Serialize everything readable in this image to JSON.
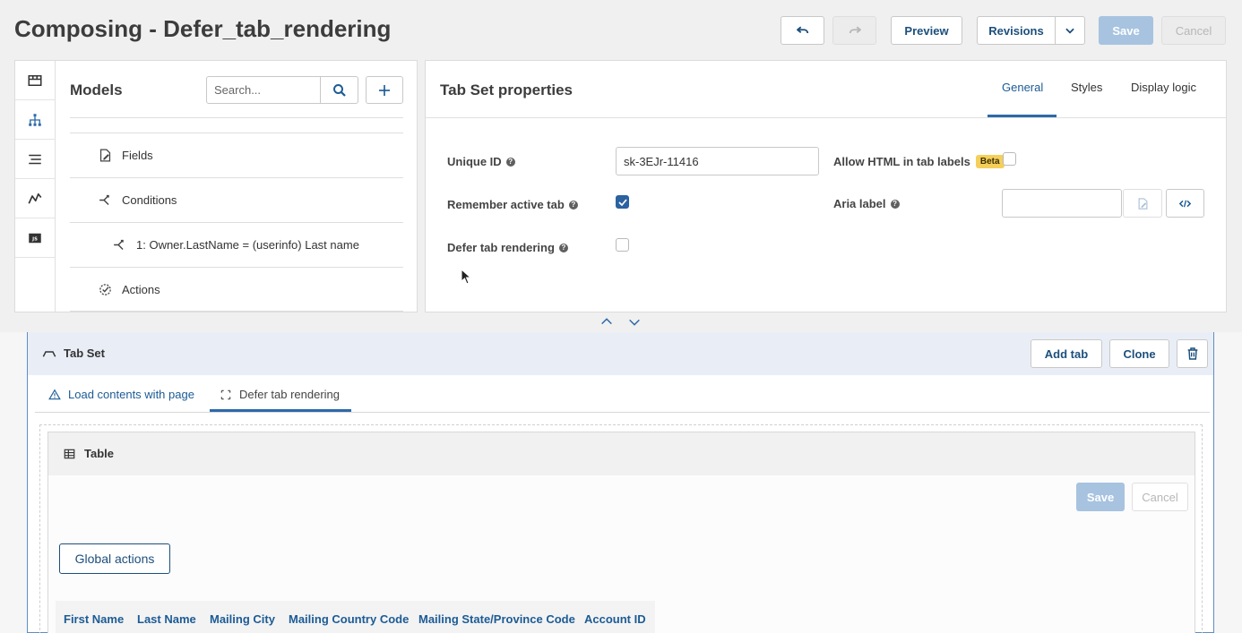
{
  "header": {
    "title": "Composing - Defer_tab_rendering",
    "preview_label": "Preview",
    "revisions_label": "Revisions",
    "save_label": "Save",
    "cancel_label": "Cancel"
  },
  "models_panel": {
    "title": "Models",
    "search_placeholder": "Search...",
    "tree": {
      "fields": "Fields",
      "conditions": "Conditions",
      "condition_1": "1: Owner.LastName = (userinfo) Last name",
      "actions": "Actions"
    }
  },
  "properties": {
    "title": "Tab Set properties",
    "tabs": [
      "General",
      "Styles",
      "Display logic"
    ],
    "active_tab": "General",
    "unique_id_label": "Unique ID",
    "unique_id_value": "sk-3EJr-11416",
    "allow_html_label": "Allow HTML in tab labels",
    "beta_badge": "Beta",
    "allow_html_checked": false,
    "remember_active_label": "Remember active tab",
    "remember_active_checked": true,
    "aria_label": "Aria label",
    "defer_label": "Defer tab rendering",
    "defer_checked": false
  },
  "tabset": {
    "title": "Tab Set",
    "add_tab_label": "Add tab",
    "clone_label": "Clone",
    "tabs": [
      "Load contents with page",
      "Defer tab rendering"
    ],
    "active_tab": "Defer tab rendering"
  },
  "table": {
    "title": "Table",
    "save_label": "Save",
    "cancel_label": "Cancel",
    "global_actions_label": "Global actions",
    "columns": [
      "First Name",
      "Last Name",
      "Mailing City",
      "Mailing Country Code",
      "Mailing State/Province Code",
      "Account ID"
    ]
  },
  "colors": {
    "accent": "#2c6aa8",
    "link": "#1c5b95",
    "beta": "#f5cf5a"
  }
}
